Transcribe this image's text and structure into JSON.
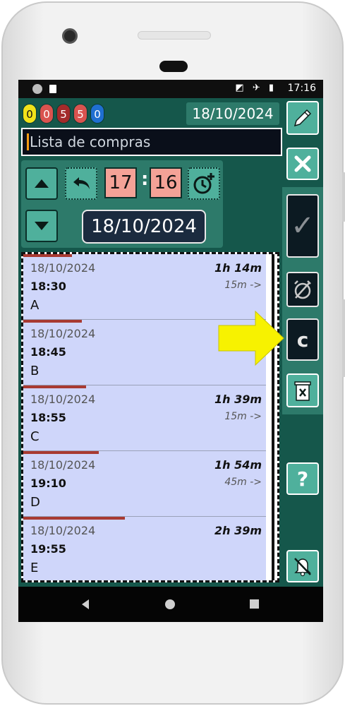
{
  "status_bar": {
    "time": "17:16",
    "icons": "◩ ✈ ▮"
  },
  "counters": [
    {
      "value": "0",
      "color": "#f1e21a",
      "text_color": "#111111"
    },
    {
      "value": "0",
      "color": "#d9534f",
      "text_color": "#ffffff"
    },
    {
      "value": "5",
      "color": "#a32a2a",
      "text_color": "#ffffff"
    },
    {
      "value": "5",
      "color": "#d9534f",
      "text_color": "#ffffff"
    },
    {
      "value": "0",
      "color": "#1f6fd1",
      "text_color": "#ffffff"
    }
  ],
  "header": {
    "date": "18/10/2024"
  },
  "title_field": {
    "value": "Lista de compras"
  },
  "time_picker": {
    "hour": "17",
    "minute": "16",
    "separator": ":",
    "date": "18/10/2024"
  },
  "events": [
    {
      "date": "18/10/2024",
      "time": "18:30",
      "name": "A",
      "duration": "1h 14m",
      "gap": "15m ->",
      "progress": 0.2
    },
    {
      "date": "18/10/2024",
      "time": "18:45",
      "name": "B",
      "duration": "",
      "gap": "",
      "progress": 0.24
    },
    {
      "date": "18/10/2024",
      "time": "18:55",
      "name": "C",
      "duration": "1h 39m",
      "gap": "15m ->",
      "progress": 0.26
    },
    {
      "date": "18/10/2024",
      "time": "19:10",
      "name": "D",
      "duration": "1h 54m",
      "gap": "45m ->",
      "progress": 0.31
    },
    {
      "date": "18/10/2024",
      "time": "19:55",
      "name": "E",
      "duration": "2h 39m",
      "gap": "",
      "progress": 0.42
    }
  ],
  "side_buttons": {
    "c_label": "c",
    "help_label": "?",
    "check_label": "✓"
  },
  "colors": {
    "app_bg": "#15574b",
    "panel": "#2d7a6a",
    "button": "#4fb09c",
    "list_bg": "#cfd6fa",
    "arrow": "#f7f200"
  }
}
